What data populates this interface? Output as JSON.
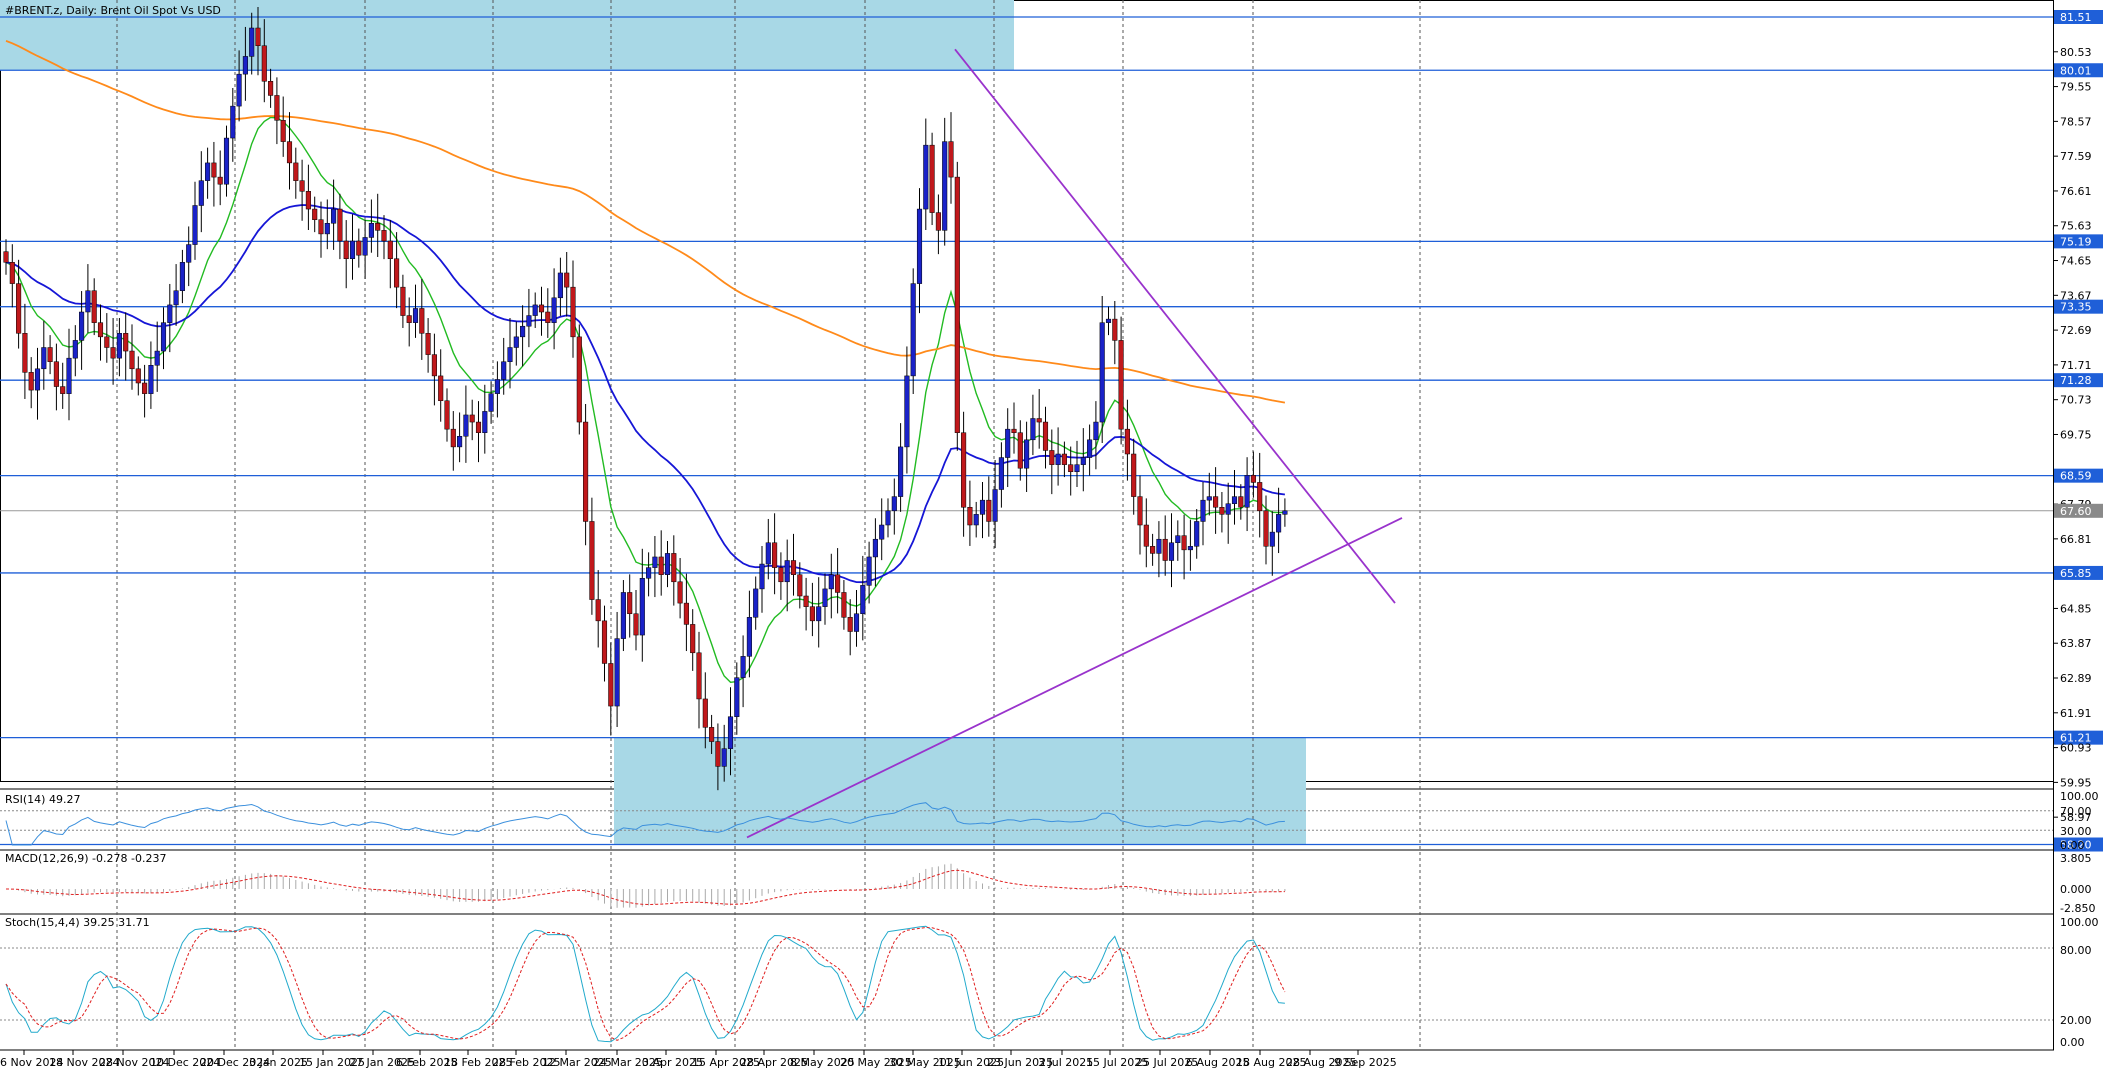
{
  "title": "#BRENT.z, Daily:  Brent Oil Spot Vs USD",
  "colors": {
    "bull": "#1a22c8",
    "bear": "#c0181b",
    "ema_fast": "#22bb22",
    "ema_mid": "#1616d6",
    "ema_slow": "#ff8a1a",
    "trend": "#9933cc",
    "level": "#1f5fd8",
    "zone": "#a8d8e6",
    "rsi": "#3c90dd",
    "macd_signal": "#e02020",
    "stoch_main": "#22aacc",
    "stoch_signal": "#e02020",
    "price_tag": "#1f5fd8",
    "current_tag": "#8a8a8a"
  },
  "price_axis": [
    "81.51",
    "80.53",
    "80.01",
    "79.55",
    "78.57",
    "77.59",
    "76.61",
    "75.63",
    "75.19",
    "74.65",
    "73.67",
    "73.35",
    "72.69",
    "71.71",
    "71.28",
    "70.73",
    "69.75",
    "68.59",
    "67.79",
    "67.60",
    "66.81",
    "65.85",
    "64.85",
    "63.87",
    "62.89",
    "61.91",
    "61.21",
    "60.93",
    "59.95",
    "58.97",
    "58.20"
  ],
  "price_tags": [
    "81.51",
    "80.01",
    "75.19",
    "73.35",
    "71.28",
    "68.59",
    "65.85",
    "61.21",
    "58.20"
  ],
  "current_price": "67.60",
  "date_axis": [
    "6 Nov 2024",
    "18 Nov 2024",
    "28 Nov 2024",
    "10 Dec 2024",
    "20 Dec 2024",
    "3 Jan 2025",
    "15 Jan 2025",
    "27 Jan 2025",
    "6 Feb 2025",
    "18 Feb 2025",
    "28 Feb 2025",
    "12 Mar 2025",
    "24 Mar 2025",
    "3 Apr 2025",
    "15 Apr 2025",
    "28 Apr 2025",
    "8 May 2025",
    "20 May 2025",
    "30 May 2025",
    "11 Jun 2025",
    "23 Jun 2025",
    "3 Jul 2025",
    "15 Jul 2025",
    "25 Jul 2025",
    "6 Aug 2025",
    "18 Aug 2025",
    "28 Aug 2025",
    "9 Sep 2025"
  ],
  "rsi": {
    "label": "RSI(14) 49.27",
    "axis": [
      "100.00",
      "70.00",
      "30.00",
      "0.00"
    ]
  },
  "macd": {
    "label": "MACD(12,26,9) -0.278 -0.237",
    "axis": [
      "3.805",
      "0.000",
      "-2.850"
    ]
  },
  "stoch": {
    "label": "Stoch(15,4,4) 39.25 31.71",
    "axis": [
      "100.00",
      "80.00",
      "20.00",
      "0.00"
    ]
  },
  "chart_data": {
    "type": "candlestick",
    "symbol": "#BRENT.z",
    "timeframe": "Daily",
    "description": "Brent Oil Spot Vs USD",
    "ylim": [
      57.8,
      82.1
    ],
    "horizontal_levels": [
      81.51,
      80.01,
      75.19,
      73.35,
      71.28,
      68.59,
      65.85,
      61.21,
      58.2
    ],
    "current_price": 67.6,
    "zones": [
      {
        "from_date": "6 Nov 2024",
        "to_date": "23 Jun 2025",
        "low": 80.01,
        "high": 82.1
      },
      {
        "from_date": "3 Apr 2025",
        "to_date": "9 Sep 2025",
        "low": 58.2,
        "high": 61.21
      }
    ],
    "trendlines": [
      {
        "from": {
          "date": "23 Jun 2025",
          "price": 80.6
        },
        "to": {
          "date": "9 Sep 2025",
          "price": 65.0
        }
      },
      {
        "from": {
          "date": "28 Apr 2025",
          "price": 58.4
        },
        "to": {
          "date": "9 Sep 2025",
          "price": 67.4
        }
      }
    ],
    "close": [
      74.6,
      74.0,
      72.6,
      71.5,
      71.0,
      71.6,
      72.2,
      71.8,
      71.1,
      70.9,
      71.9,
      72.4,
      73.2,
      73.8,
      72.9,
      72.5,
      72.2,
      71.9,
      72.6,
      72.1,
      71.6,
      71.2,
      70.9,
      71.7,
      72.1,
      72.9,
      73.4,
      73.8,
      74.6,
      75.1,
      76.2,
      76.9,
      77.4,
      77.0,
      76.8,
      78.1,
      79.0,
      79.9,
      80.4,
      81.2,
      80.7,
      79.7,
      79.3,
      78.6,
      78.0,
      77.4,
      76.9,
      76.6,
      76.1,
      75.8,
      75.4,
      75.7,
      76.1,
      75.2,
      74.7,
      75.2,
      74.8,
      75.3,
      75.7,
      75.5,
      75.2,
      74.7,
      73.9,
      73.1,
      72.9,
      73.3,
      72.6,
      72.0,
      71.4,
      70.7,
      69.9,
      69.4,
      69.7,
      70.3,
      70.1,
      69.8,
      70.4,
      70.9,
      71.3,
      71.8,
      72.2,
      72.5,
      72.8,
      73.1,
      73.4,
      73.2,
      72.9,
      73.6,
      74.3,
      73.9,
      72.5,
      70.1,
      67.3,
      65.1,
      64.5,
      63.3,
      62.1,
      64.0,
      65.3,
      64.7,
      64.1,
      65.7,
      66.0,
      66.3,
      65.8,
      66.4,
      65.6,
      65.0,
      64.4,
      63.6,
      62.3,
      61.5,
      61.1,
      60.4,
      60.9,
      61.8,
      62.9,
      63.5,
      64.6,
      65.4,
      66.1,
      66.7,
      66.0,
      65.6,
      66.2,
      65.8,
      65.2,
      64.9,
      64.5,
      64.9,
      65.4,
      65.8,
      65.3,
      64.6,
      64.2,
      64.7,
      65.5,
      66.3,
      66.8,
      67.2,
      67.6,
      68.0,
      69.4,
      71.4,
      74.0,
      76.1,
      77.9,
      76.0,
      75.5,
      78.0,
      77.0,
      69.8,
      67.7,
      67.2,
      67.5,
      67.9,
      67.3,
      68.2,
      69.1,
      69.9,
      69.8,
      68.8,
      69.6,
      70.2,
      70.1,
      69.3,
      68.9,
      69.2,
      68.9,
      68.7,
      68.9,
      69.1,
      69.6,
      70.1,
      72.9,
      73.0,
      72.4,
      69.9,
      69.2,
      68.0,
      67.2,
      66.6,
      66.4,
      66.8,
      66.2,
      66.7,
      66.9,
      66.5,
      66.6,
      67.3,
      67.9,
      68.0,
      67.7,
      67.5,
      67.8,
      68.0,
      67.7,
      68.6,
      68.4,
      67.6,
      66.6,
      67.0,
      67.5,
      67.6
    ],
    "ema_fast_label": "green moving average",
    "ema_mid_label": "blue moving average",
    "ema_slow_label": "orange moving average",
    "rsi_value": 49.27,
    "macd_values": [
      -0.278,
      -0.237
    ],
    "stoch_values": [
      39.25,
      31.71
    ],
    "grid": "vertical dotted"
  }
}
